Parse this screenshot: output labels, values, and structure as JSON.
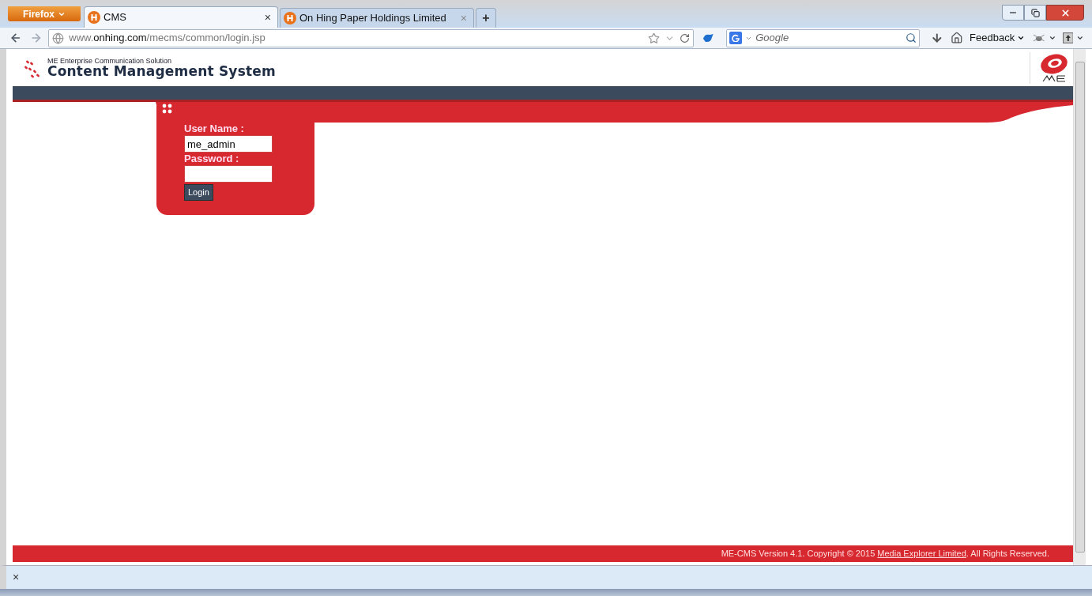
{
  "browser": {
    "menu_button": "Firefox",
    "tabs": [
      {
        "title": "CMS",
        "selected": true,
        "close": "×"
      },
      {
        "title": "On Hing Paper Holdings Limited",
        "selected": false,
        "close": "×"
      }
    ],
    "new_tab": "+",
    "url_parts": [
      {
        "text": "www.",
        "emphasized": false
      },
      {
        "text": "onhing.com",
        "emphasized": true
      },
      {
        "text": "/mecms/common/login.jsp",
        "emphasized": false
      }
    ],
    "search": {
      "placeholder": "Google"
    },
    "feedback": "Feedback",
    "addon_bar_close": "×"
  },
  "header": {
    "subtitle": "ME Enterprise Communication Solution",
    "title": "Content Management System"
  },
  "login": {
    "fields": [
      {
        "label": "User Name :",
        "value": "me_admin",
        "kind": "text"
      },
      {
        "label": "Password :",
        "kind": "password"
      }
    ],
    "button": "Login"
  },
  "footer": {
    "before": "ME-CMS Version 4.1. Copyright © 2015 ",
    "link": "Media Explorer Limited",
    "after": ". All Rights Reserved."
  }
}
